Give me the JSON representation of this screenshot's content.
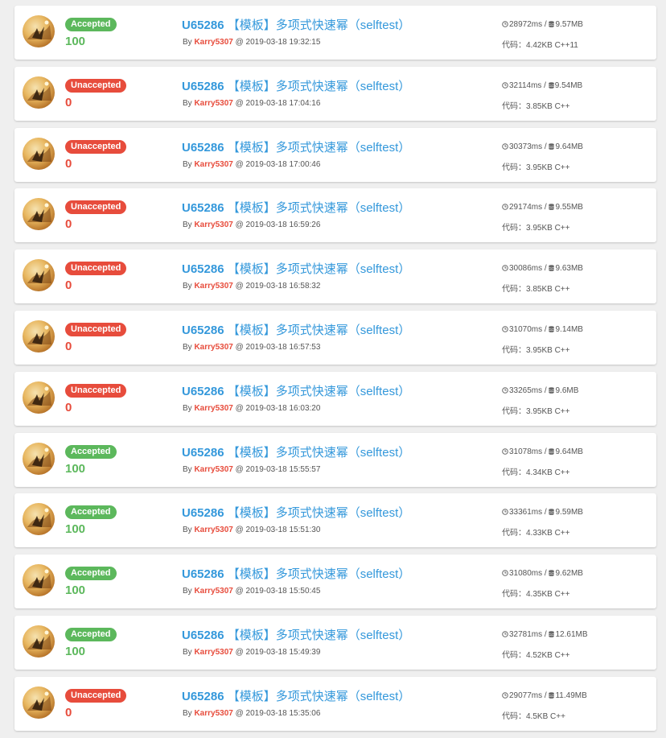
{
  "records": [
    {
      "status": "Accepted",
      "result": "ac",
      "score": "100",
      "problem_id": "U65286",
      "problem_title": "【模板】多项式快速幂（selftest）",
      "by_label": "By",
      "user": "Karry5307",
      "at_label": "@",
      "datetime": "2019-03-18 19:32:15",
      "time": "28972ms",
      "memory": "9.57MB",
      "code_label": "代码：",
      "code_info": "4.42KB C++11"
    },
    {
      "status": "Unaccepted",
      "result": "wa",
      "score": "0",
      "problem_id": "U65286",
      "problem_title": "【模板】多项式快速幂（selftest）",
      "by_label": "By",
      "user": "Karry5307",
      "at_label": "@",
      "datetime": "2019-03-18 17:04:16",
      "time": "32114ms",
      "memory": "9.54MB",
      "code_label": "代码：",
      "code_info": "3.85KB C++"
    },
    {
      "status": "Unaccepted",
      "result": "wa",
      "score": "0",
      "problem_id": "U65286",
      "problem_title": "【模板】多项式快速幂（selftest）",
      "by_label": "By",
      "user": "Karry5307",
      "at_label": "@",
      "datetime": "2019-03-18 17:00:46",
      "time": "30373ms",
      "memory": "9.64MB",
      "code_label": "代码：",
      "code_info": "3.95KB C++"
    },
    {
      "status": "Unaccepted",
      "result": "wa",
      "score": "0",
      "problem_id": "U65286",
      "problem_title": "【模板】多项式快速幂（selftest）",
      "by_label": "By",
      "user": "Karry5307",
      "at_label": "@",
      "datetime": "2019-03-18 16:59:26",
      "time": "29174ms",
      "memory": "9.55MB",
      "code_label": "代码：",
      "code_info": "3.95KB C++"
    },
    {
      "status": "Unaccepted",
      "result": "wa",
      "score": "0",
      "problem_id": "U65286",
      "problem_title": "【模板】多项式快速幂（selftest）",
      "by_label": "By",
      "user": "Karry5307",
      "at_label": "@",
      "datetime": "2019-03-18 16:58:32",
      "time": "30086ms",
      "memory": "9.63MB",
      "code_label": "代码：",
      "code_info": "3.85KB C++"
    },
    {
      "status": "Unaccepted",
      "result": "wa",
      "score": "0",
      "problem_id": "U65286",
      "problem_title": "【模板】多项式快速幂（selftest）",
      "by_label": "By",
      "user": "Karry5307",
      "at_label": "@",
      "datetime": "2019-03-18 16:57:53",
      "time": "31070ms",
      "memory": "9.14MB",
      "code_label": "代码：",
      "code_info": "3.95KB C++"
    },
    {
      "status": "Unaccepted",
      "result": "wa",
      "score": "0",
      "problem_id": "U65286",
      "problem_title": "【模板】多项式快速幂（selftest）",
      "by_label": "By",
      "user": "Karry5307",
      "at_label": "@",
      "datetime": "2019-03-18 16:03:20",
      "time": "33265ms",
      "memory": "9.6MB",
      "code_label": "代码：",
      "code_info": "3.95KB C++"
    },
    {
      "status": "Accepted",
      "result": "ac",
      "score": "100",
      "problem_id": "U65286",
      "problem_title": "【模板】多项式快速幂（selftest）",
      "by_label": "By",
      "user": "Karry5307",
      "at_label": "@",
      "datetime": "2019-03-18 15:55:57",
      "time": "31078ms",
      "memory": "9.64MB",
      "code_label": "代码：",
      "code_info": "4.34KB C++"
    },
    {
      "status": "Accepted",
      "result": "ac",
      "score": "100",
      "problem_id": "U65286",
      "problem_title": "【模板】多项式快速幂（selftest）",
      "by_label": "By",
      "user": "Karry5307",
      "at_label": "@",
      "datetime": "2019-03-18 15:51:30",
      "time": "33361ms",
      "memory": "9.59MB",
      "code_label": "代码：",
      "code_info": "4.33KB C++"
    },
    {
      "status": "Accepted",
      "result": "ac",
      "score": "100",
      "problem_id": "U65286",
      "problem_title": "【模板】多项式快速幂（selftest）",
      "by_label": "By",
      "user": "Karry5307",
      "at_label": "@",
      "datetime": "2019-03-18 15:50:45",
      "time": "31080ms",
      "memory": "9.62MB",
      "code_label": "代码：",
      "code_info": "4.35KB C++"
    },
    {
      "status": "Accepted",
      "result": "ac",
      "score": "100",
      "problem_id": "U65286",
      "problem_title": "【模板】多项式快速幂（selftest）",
      "by_label": "By",
      "user": "Karry5307",
      "at_label": "@",
      "datetime": "2019-03-18 15:49:39",
      "time": "32781ms",
      "memory": "12.61MB",
      "code_label": "代码：",
      "code_info": "4.52KB C++"
    },
    {
      "status": "Unaccepted",
      "result": "wa",
      "score": "0",
      "problem_id": "U65286",
      "problem_title": "【模板】多项式快速幂（selftest）",
      "by_label": "By",
      "user": "Karry5307",
      "at_label": "@",
      "datetime": "2019-03-18 15:35:06",
      "time": "29077ms",
      "memory": "11.49MB",
      "code_label": "代码：",
      "code_info": "4.5KB C++"
    }
  ],
  "icons": {
    "time": "clock-icon",
    "memory": "database-icon"
  },
  "colors": {
    "accepted": "#5cb85c",
    "unaccepted": "#e74c3c",
    "link": "#3498db",
    "user": "#e74c3c"
  },
  "separator": " / "
}
